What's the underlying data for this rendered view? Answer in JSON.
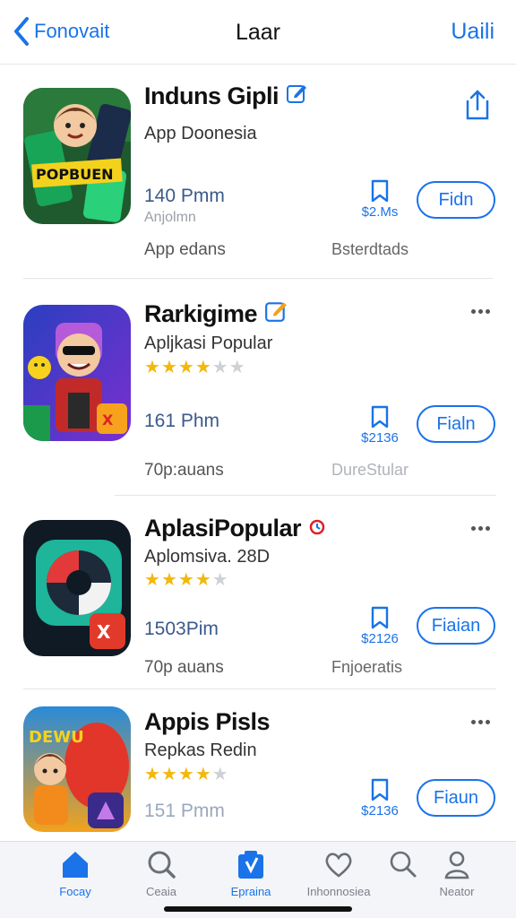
{
  "nav": {
    "back_label": "Fonovait",
    "title": "Laar",
    "right_label": "Uaili"
  },
  "colors": {
    "accent": "#1a73e8",
    "star": "#f2b90c"
  },
  "apps": [
    {
      "name": "Induns Gipli",
      "subtitle": "App Doonesia",
      "price_line": "140 Pmm",
      "size_line": "Anjolmn",
      "bookmark_price": "$2.Ms",
      "action_label": "Fidn",
      "meta_left": "App edans",
      "meta_right": "Bsterdtads",
      "icon": "game-comic-icon",
      "badge_icon": "edit-icon",
      "corner_icon": "share-icon"
    },
    {
      "name": "Rarkigime",
      "subtitle": "Apljkasi Popular",
      "rating": 3.5,
      "price_line": "161 Phm",
      "bookmark_price": "$2136",
      "action_label": "Fialn",
      "meta_left": "70p:auans",
      "meta_right": "DureStular",
      "icon": "cartoon-character-icon",
      "badge_icon": "edit-icon",
      "corner_icon": "more-icon"
    },
    {
      "name": "AplasiPopular",
      "subtitle": "Aplomsiva. 28D",
      "rating": 3.5,
      "price_line": "1503Pim",
      "bookmark_price": "$2126",
      "action_label": "Fiaian",
      "meta_left": "70p auans",
      "meta_right": "Fnjoeratis",
      "icon": "camera-lens-icon",
      "badge_icon": "clock-icon",
      "corner_icon": "more-icon"
    },
    {
      "name": "Appis Pisls",
      "subtitle": "Repkas Redin",
      "rating": 3.5,
      "price_line": "151 Pmm",
      "bookmark_price": "$2136",
      "action_label": "Fiaun",
      "icon": "kid-balloon-icon",
      "corner_icon": "more-icon"
    }
  ],
  "tabs": [
    {
      "label": "Focay",
      "icon": "home-icon",
      "active": true
    },
    {
      "label": "Ceaia",
      "icon": "search-icon",
      "active": false
    },
    {
      "label": "Epraina",
      "icon": "bag-icon",
      "active": true
    },
    {
      "label": "Inhonnosiea",
      "icon": "heart-icon",
      "active": false
    },
    {
      "label": "",
      "icon": "magnifier-icon",
      "active": false
    },
    {
      "label": "Neator",
      "icon": "person-icon",
      "active": false
    }
  ]
}
